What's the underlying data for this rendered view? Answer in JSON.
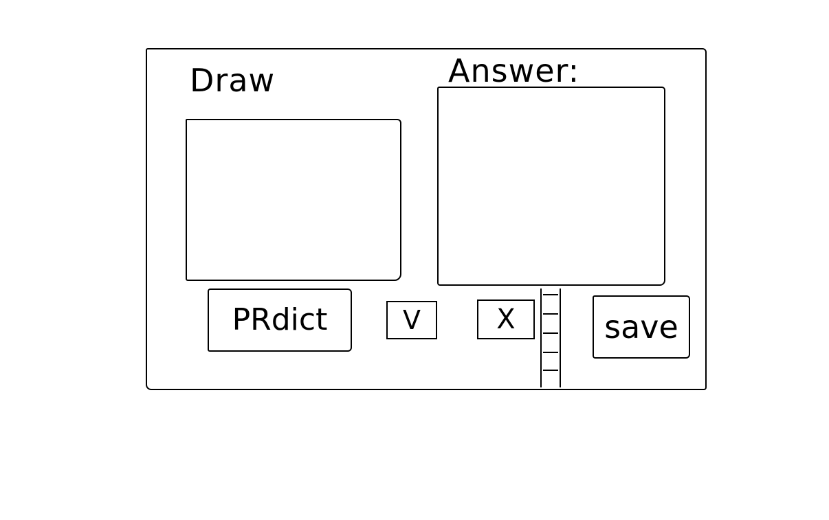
{
  "window": {
    "draw_label": "Draw",
    "answer_label": "Answer:"
  },
  "actions": {
    "predict_label": "PRdict",
    "yes_label": "V",
    "no_label": "X",
    "save_label": "save"
  },
  "icons": {
    "scrollbar": "vertical-scrollbar"
  }
}
